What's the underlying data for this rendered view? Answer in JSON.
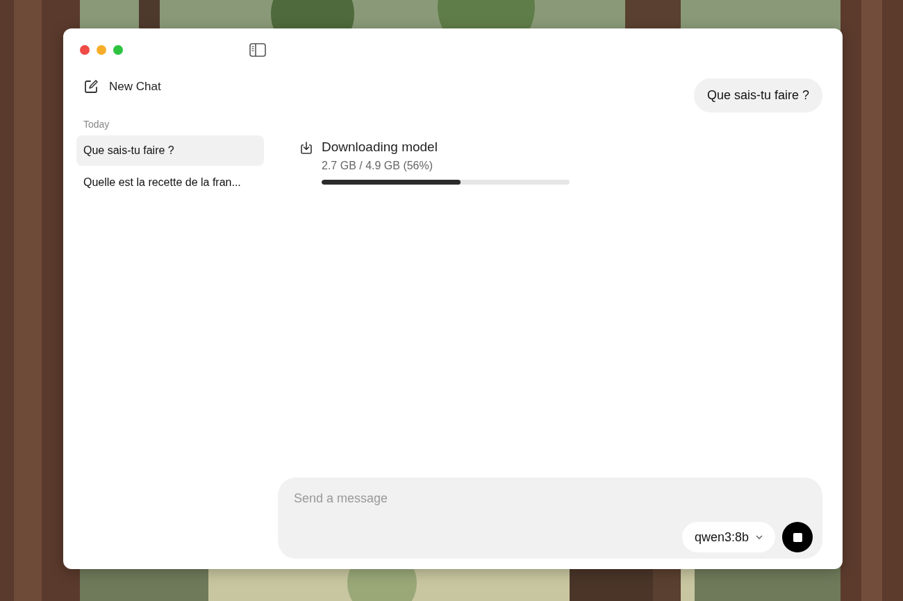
{
  "sidebar": {
    "new_chat": "New Chat",
    "section": "Today",
    "items": [
      {
        "label": "Que sais-tu faire ?",
        "selected": true
      },
      {
        "label": "Quelle est la recette de la fran...",
        "selected": false
      }
    ]
  },
  "messages": [
    {
      "kind": "user",
      "text": "Que sais-tu faire ?"
    },
    {
      "kind": "download",
      "title": "Downloading model",
      "progress": "2.7 GB / 4.9 GB (56%)",
      "level": 0.56
    }
  ],
  "composer": {
    "placeholder": "Send a message",
    "model": "qwen3:8b"
  }
}
